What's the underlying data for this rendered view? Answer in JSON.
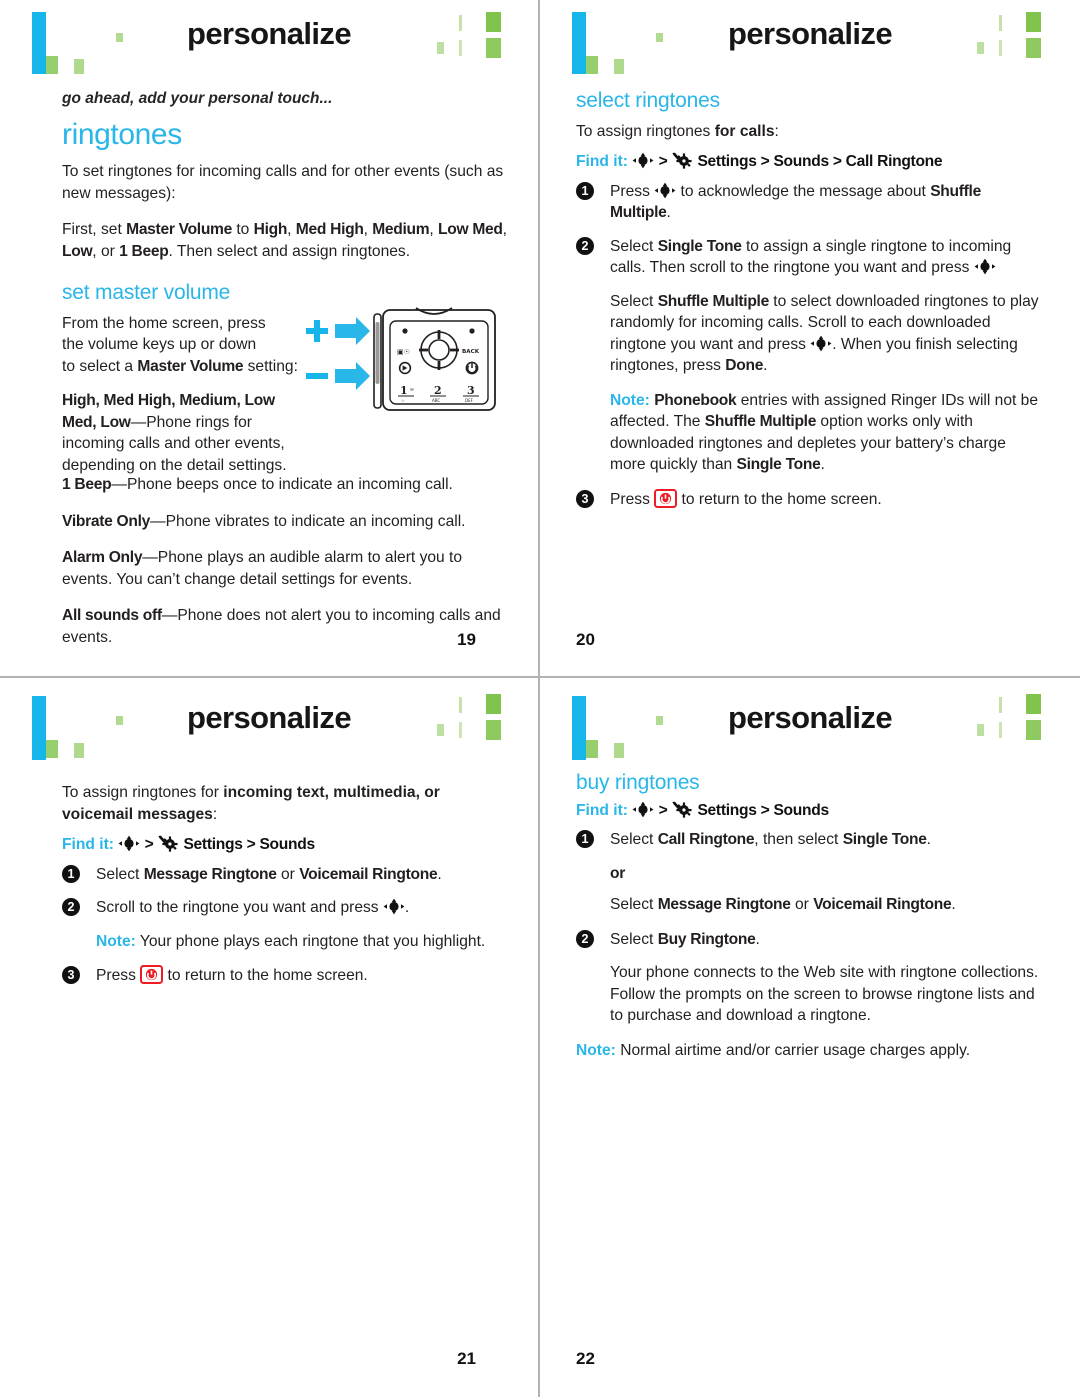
{
  "document": {
    "title": "personalize",
    "accent_cyan": "#29b6e8",
    "accent_green": "#7ac143",
    "accent_blue_bar": "#16b5ea",
    "power_key_red": "#ed1c24"
  },
  "icons": {
    "nav_key": "nav-key-icon",
    "settings": "settings-gear-icon",
    "power": "power-end-key-icon",
    "volume_up": "volume-up-icon",
    "volume_down": "volume-down-icon"
  },
  "pages": [
    {
      "header_title": "personalize",
      "page_number": "19",
      "tagline": "go ahead, add your personal touch...",
      "section_title": "ringtones",
      "intro": "To set ringtones for incoming calls and for other events (such as new messages):",
      "first_line": {
        "lead": "First, set ",
        "b1": "Master Volume",
        "mid": " to ",
        "b2": "High",
        "b3": "Med High",
        "b4": "Medium",
        "b5": "Low Med",
        "b6": "Low",
        "or": ", or ",
        "b7": "1 Beep",
        "tail": ". Then select and assign ringtones."
      },
      "subsection_title": "set master volume",
      "volume_intro": {
        "l1": "From the home screen, press",
        "l2": "the volume keys up or down",
        "l3a": "to select a ",
        "l3b": "Master Volume",
        "l3c": " setting:"
      },
      "definitions": [
        {
          "terms": "High, Med High, Medium, Low Med, Low",
          "text": "—Phone rings for incoming calls and other events, depending on the detail settings."
        },
        {
          "terms": "1 Beep",
          "text": "—Phone beeps once to indicate an incoming call."
        },
        {
          "terms": "Vibrate Only",
          "text": "—Phone vibrates to indicate an incoming call."
        },
        {
          "terms": "Alarm Only",
          "text": "—Phone plays an audible alarm to alert you to events. You can’t change detail settings for events."
        },
        {
          "terms": "All sounds off",
          "text": "—Phone does not alert you to incoming calls and events."
        }
      ],
      "illustration_keys": [
        "1",
        "2",
        "3"
      ],
      "illustration_key_sub": [
        "DEF"
      ],
      "illustration_back_label": "BACK"
    },
    {
      "header_title": "personalize",
      "page_number": "20",
      "subsection_title": "select ringtones",
      "assign_intro_lead": "To assign ringtones ",
      "assign_intro_bold": "for calls",
      "assign_intro_tail": ":",
      "find_it_label": "Find it:",
      "find_it_path": "Settings > Sounds > Call Ringtone",
      "steps": [
        {
          "num": "1",
          "parts": {
            "a": "Press ",
            "b": " to acknowledge the message about ",
            "c": "Shuffle Multiple",
            "d": "."
          }
        },
        {
          "num": "2",
          "parts": {
            "a": "Select ",
            "b": "Single Tone",
            "c": " to assign a single ringtone to incoming calls. Then scroll to the ringtone you want and press ",
            "d": ""
          }
        },
        {
          "num": "3",
          "parts": {
            "a": "Press ",
            "b": " to return to the home screen."
          }
        }
      ],
      "sub_paragraph": {
        "a": "Select ",
        "b": "Shuffle Multiple",
        "c": " to select downloaded ringtones to play randomly for incoming calls. Scroll to each downloaded ringtone you want and press ",
        "d": ". When you finish selecting ringtones, press ",
        "e": "Done",
        "f": "."
      },
      "note": {
        "label": "Note:",
        "a": " ",
        "b": "Phonebook",
        "c": " entries with assigned Ringer IDs will not be affected. The ",
        "d": "Shuffle Multiple",
        "e": " option works only with downloaded ringtones and depletes your battery’s charge more quickly than ",
        "f": "Single Tone",
        "g": "."
      }
    },
    {
      "header_title": "personalize",
      "page_number": "21",
      "assign_intro_lead": "To assign ringtones for ",
      "assign_intro_bold": "incoming text, multimedia, or voicemail messages",
      "assign_intro_tail": ":",
      "find_it_label": "Find it:",
      "find_it_path": "Settings > Sounds",
      "steps": [
        {
          "num": "1",
          "parts": {
            "a": "Select ",
            "b": "Message Ringtone",
            "c": " or ",
            "d": "Voicemail Ringtone",
            "e": "."
          }
        },
        {
          "num": "2",
          "parts": {
            "a": "Scroll to the ringtone you want and press ",
            "b": "."
          }
        },
        {
          "num": "3",
          "parts": {
            "a": "Press ",
            "b": " to return to the home screen."
          }
        }
      ],
      "note": {
        "label": "Note:",
        "text": " Your phone plays each ringtone that you highlight."
      }
    },
    {
      "header_title": "personalize",
      "page_number": "22",
      "subsection_title": "buy ringtones",
      "find_it_label": "Find it:",
      "find_it_path": "Settings > Sounds",
      "steps": [
        {
          "num": "1",
          "parts": {
            "a": "Select ",
            "b": "Call Ringtone",
            "c": ", then select ",
            "d": "Single Tone",
            "e": "."
          }
        },
        {
          "num": "2",
          "parts": {
            "a": "Select ",
            "b": "Buy Ringtone",
            "c": "."
          }
        }
      ],
      "or_label": "or",
      "or_line": {
        "a": "Select ",
        "b": "Message Ringtone",
        "c": " or ",
        "d": "Voicemail Ringtone",
        "e": "."
      },
      "body_paragraph": "Your phone connects to the Web site with ringtone collections. Follow the prompts on the screen to browse ringtone lists and to purchase and download a ringtone.",
      "note": {
        "label": "Note:",
        "text": " Normal airtime and/or carrier usage charges apply."
      }
    }
  ]
}
